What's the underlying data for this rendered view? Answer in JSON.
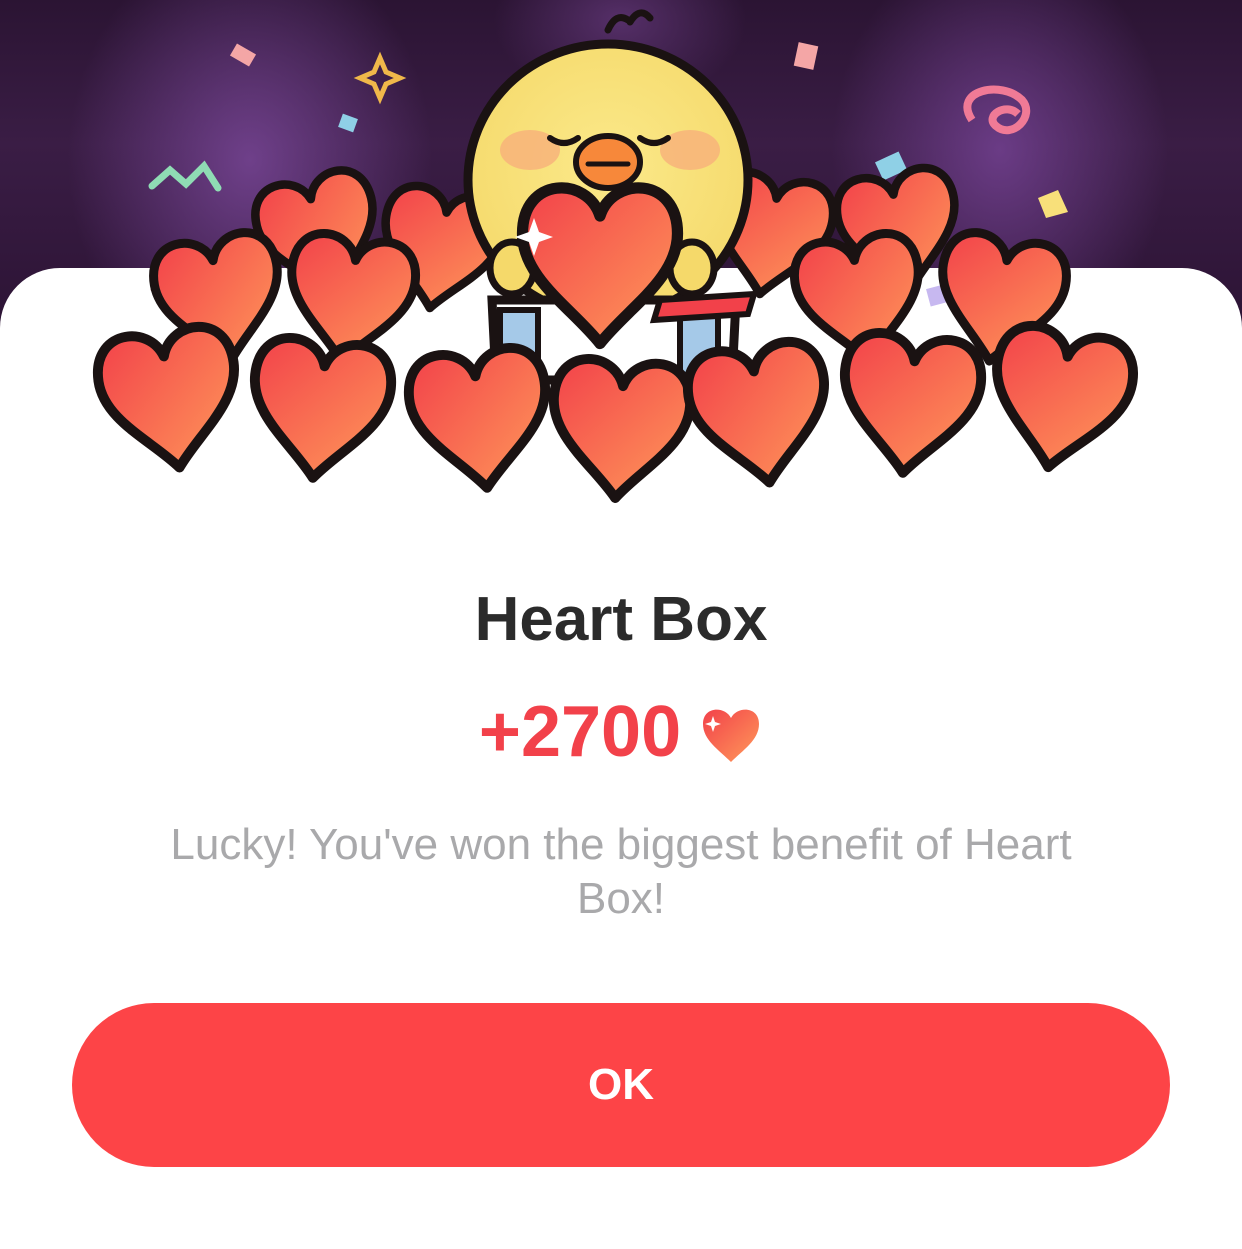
{
  "dialog": {
    "title": "Heart Box",
    "reward_amount": "+2700",
    "reward_icon": "heart-icon",
    "message": "Lucky! You've won the biggest benefit of Heart Box!",
    "ok_label": "OK"
  },
  "illustration": {
    "subject": "yellow chick holding a heart in an open gift box surrounded by hearts and confetti",
    "icon": "chick-heart-box-illustration"
  },
  "colors": {
    "accent": "#fd4447",
    "reward_text": "#f2414a",
    "title_text": "#2b2b2b",
    "message_text": "#a9a9ab",
    "heart_light": "#ff9a5a",
    "heart_dark": "#f2414a"
  }
}
